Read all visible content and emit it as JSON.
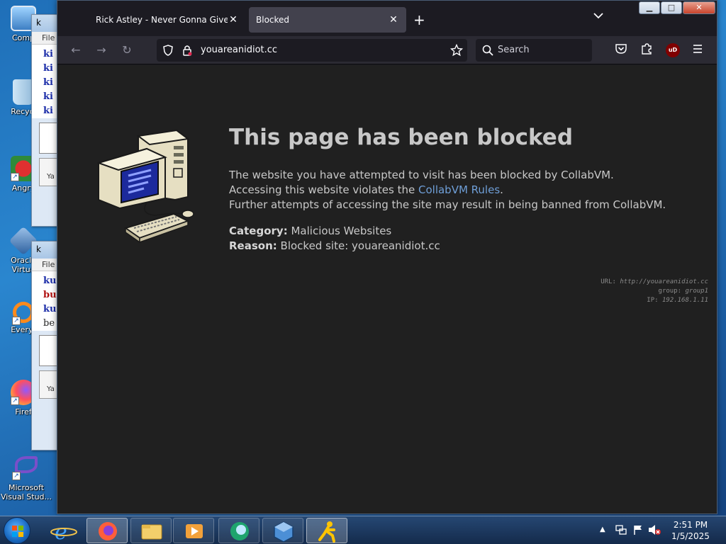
{
  "desktop": {
    "icons": [
      {
        "label": "Comp"
      },
      {
        "label": "Recycl"
      },
      {
        "label": "Angry"
      },
      {
        "label": "Oracle Virtua"
      },
      {
        "label": "Everyt"
      },
      {
        "label": "Firef"
      },
      {
        "label": "Microsoft Visual Stud..."
      }
    ]
  },
  "bg_windows": [
    {
      "title": "k",
      "menu": "File",
      "lines": [
        "ki",
        "ki",
        "ki",
        "ki",
        "ki"
      ],
      "button": "Ya"
    },
    {
      "title": "k",
      "menu": "File",
      "lines": [
        "ku",
        "bu",
        "ku",
        "be"
      ],
      "button": "Ya"
    }
  ],
  "browser": {
    "tabs": [
      {
        "label": "Rick Astley - Never Gonna Give You",
        "active": false
      },
      {
        "label": "Blocked",
        "active": true
      }
    ],
    "url": "youareanidiot.cc",
    "search_placeholder": "Search",
    "ublock_badge": "uD"
  },
  "page": {
    "headline": "This page has been blocked",
    "message": {
      "line1": "The website you have attempted to visit has been blocked by CollabVM.",
      "line2_prefix": "Accessing this website violates the ",
      "line2_link": "CollabVM Rules",
      "line2_suffix": ".",
      "line3": "Further attempts of accessing the site may result in being banned from CollabVM."
    },
    "category_label": "Category:",
    "category_value": "Malicious Websites",
    "reason_label": "Reason:",
    "reason_value": "Blocked site: youareanidiot.cc",
    "diagnostics": {
      "url_label": "URL:",
      "url_value": "http://youareanidiot.cc",
      "group_label": "group:",
      "group_value": "group1",
      "ip_label": "IP:",
      "ip_value": "192.168.1.11"
    },
    "colors": {
      "background": "#202020",
      "text": "#c8c8c8",
      "link": "#6f9fd8"
    }
  },
  "taskbar": {
    "clock_time": "2:51 PM",
    "clock_date": "1/5/2025"
  }
}
